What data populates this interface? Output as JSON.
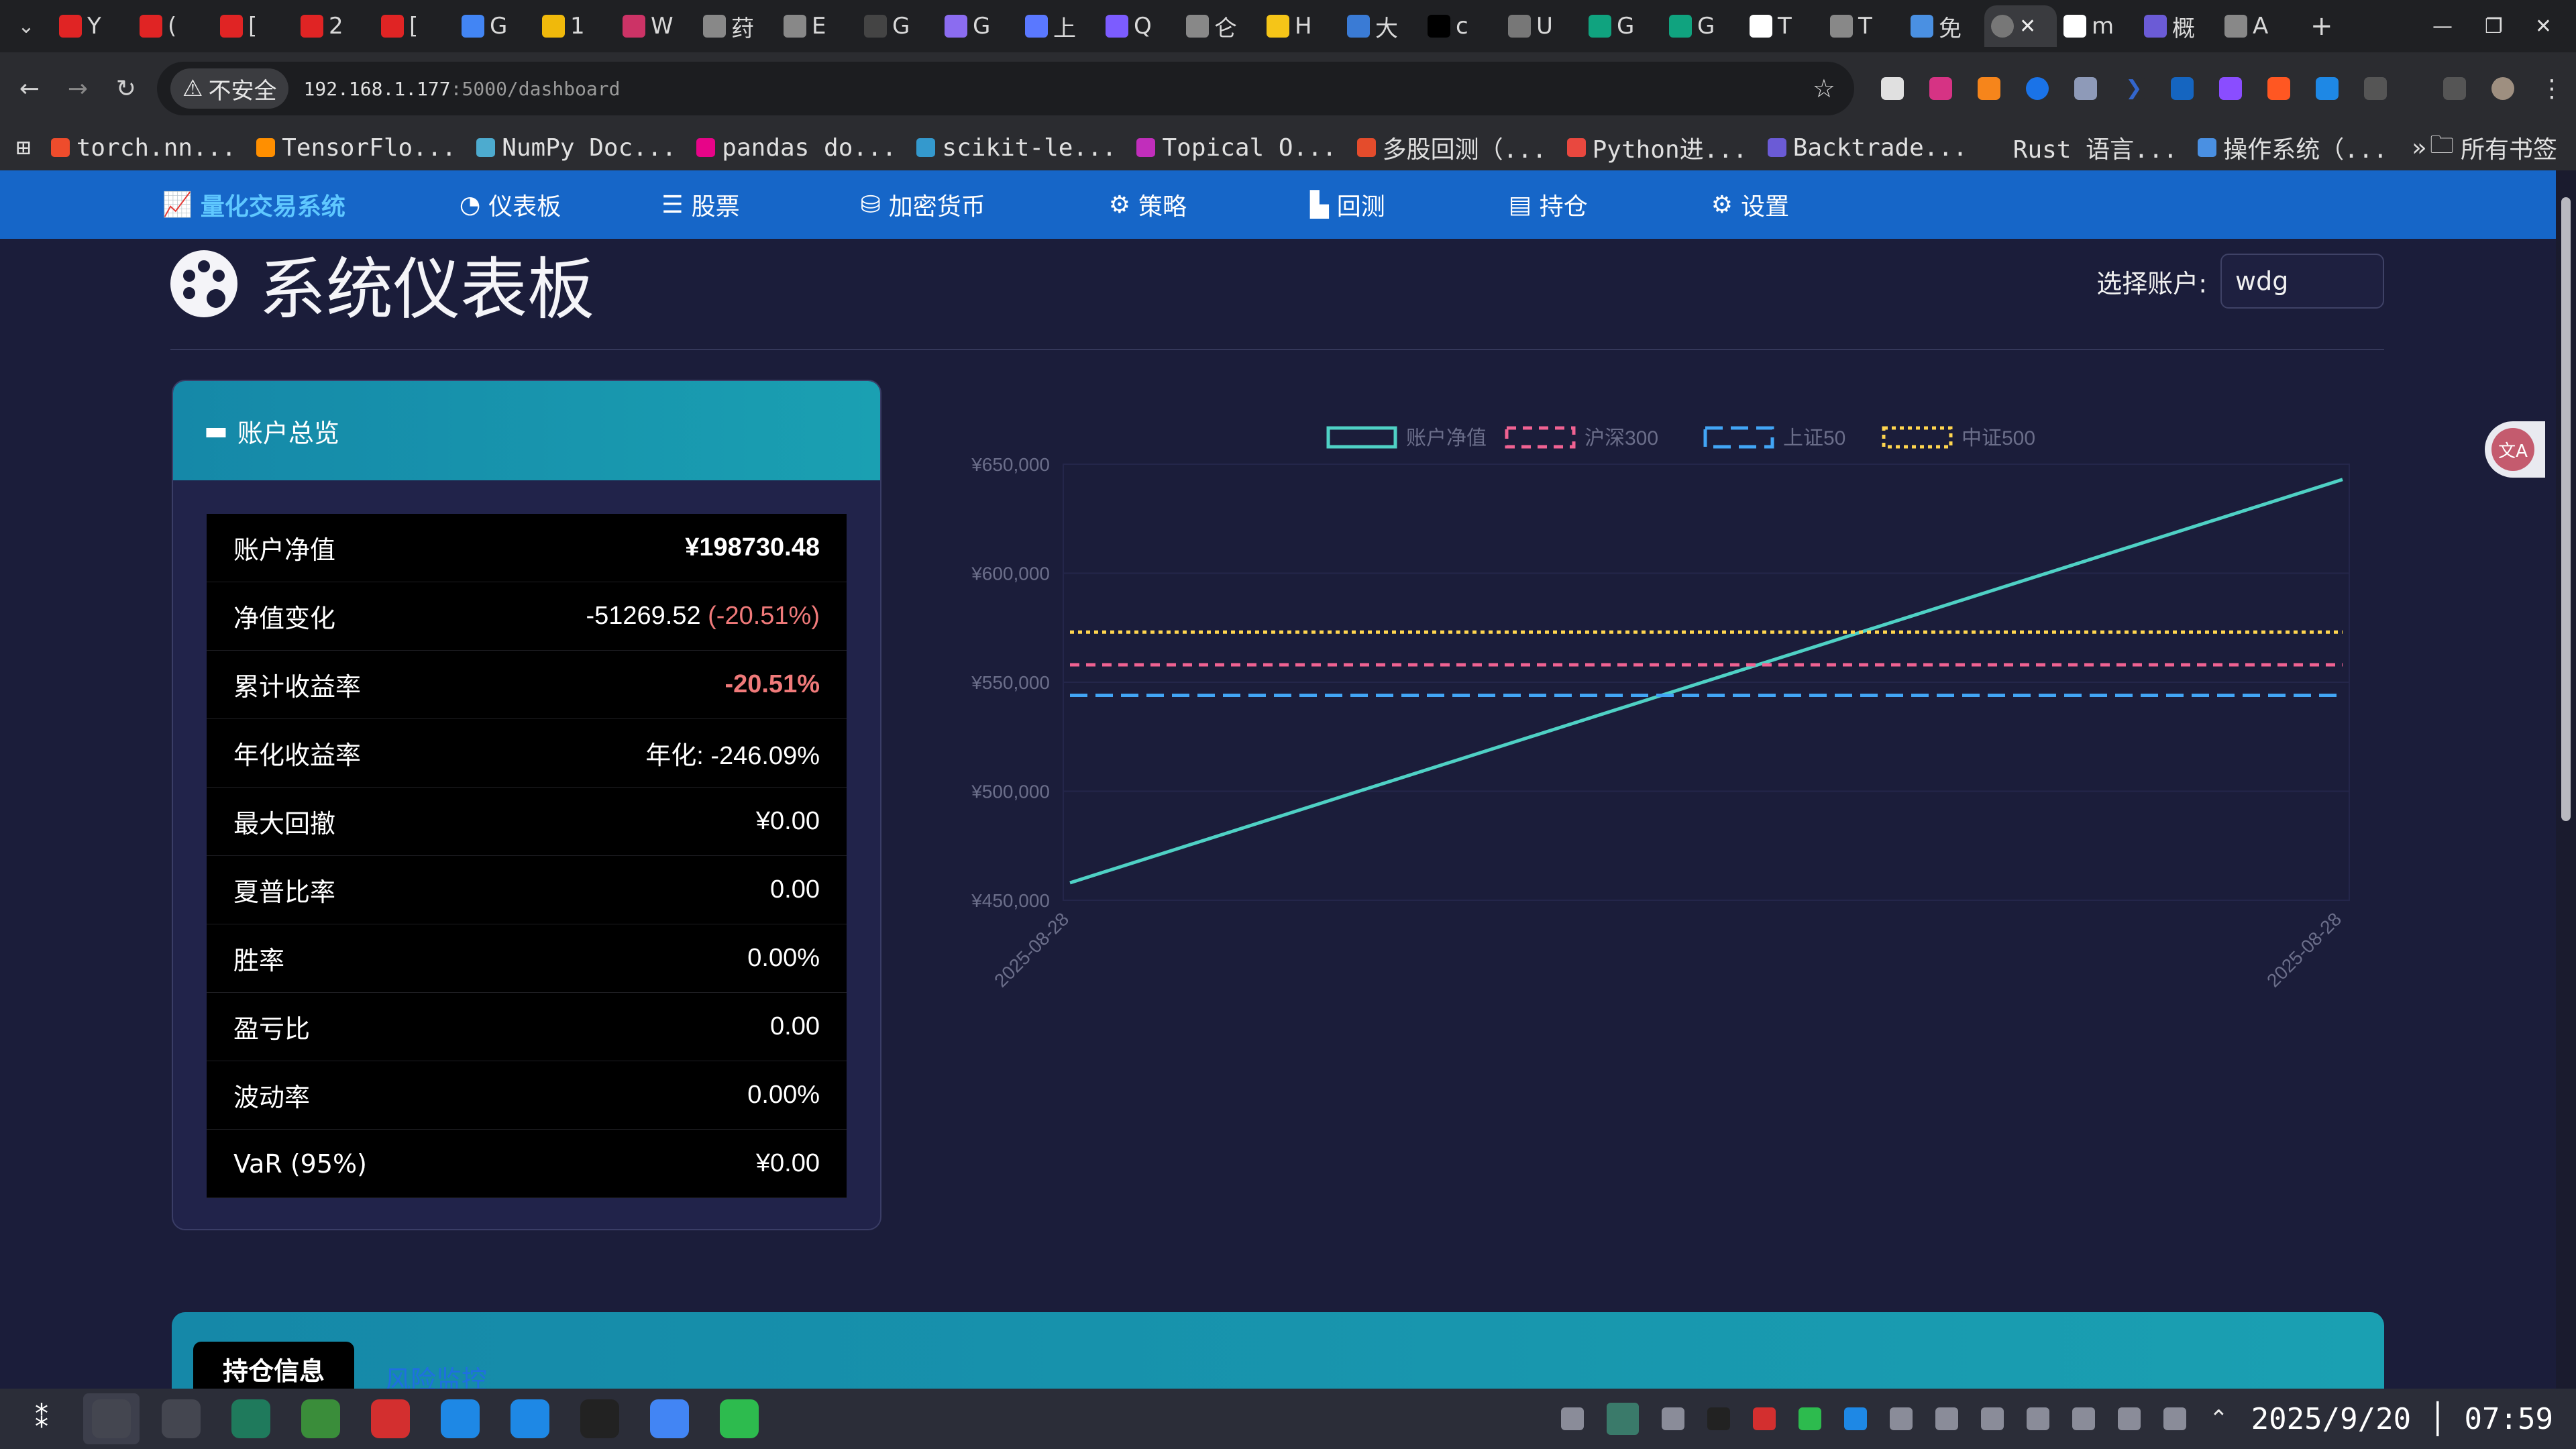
{
  "browser": {
    "tabs": [
      {
        "label": "Y",
        "color": "#e02424"
      },
      {
        "label": "(",
        "color": "#e02424"
      },
      {
        "label": "[",
        "color": "#e02424"
      },
      {
        "label": "2",
        "color": "#e02424"
      },
      {
        "label": "[",
        "color": "#e02424"
      },
      {
        "label": "G",
        "color": "#4285f4"
      },
      {
        "label": "1",
        "color": "#f0b90b"
      },
      {
        "label": "W",
        "color": "#cc3366"
      },
      {
        "label": "荮",
        "color": "#888888"
      },
      {
        "label": "E",
        "color": "#888888"
      },
      {
        "label": "G",
        "color": "#444444"
      },
      {
        "label": "G",
        "color": "#8b6cf0"
      },
      {
        "label": "上",
        "color": "#5a78ff"
      },
      {
        "label": "Q",
        "color": "#7c5cff"
      },
      {
        "label": "仑",
        "color": "#888888"
      },
      {
        "label": "H",
        "color": "#f5c518"
      },
      {
        "label": "大",
        "color": "#3a7bd5"
      },
      {
        "label": "c",
        "color": "#000000"
      },
      {
        "label": "U",
        "color": "#777777"
      },
      {
        "label": "G",
        "color": "#10a37f"
      },
      {
        "label": "G",
        "color": "#10a37f"
      },
      {
        "label": "T",
        "color": "#ffffff"
      },
      {
        "label": "T",
        "color": "#888888"
      },
      {
        "label": "免",
        "color": "#4a90e2"
      }
    ],
    "active_tab_close": "✕",
    "active_tab_icon_color": "#777777",
    "trailing_tabs": [
      {
        "label": "m",
        "color": "#ffffff"
      },
      {
        "label": "概",
        "color": "#6b5bd6"
      },
      {
        "label": "A",
        "color": "#888888"
      }
    ],
    "new_tab": "+",
    "window_controls": [
      "—",
      "❐",
      "✕"
    ],
    "insecure_label": "不安全",
    "url_host": "192.168.1.177",
    "url_rest": ":5000/dashboard",
    "bookmarks": [
      {
        "label": "torch.nn...",
        "color": "#ee4c2c"
      },
      {
        "label": "TensorFlo...",
        "color": "#ff8f00"
      },
      {
        "label": "NumPy Doc...",
        "color": "#4dabcf"
      },
      {
        "label": "pandas do...",
        "color": "#e70488"
      },
      {
        "label": "scikit-le...",
        "color": "#3499cd"
      },
      {
        "label": "Topical O...",
        "color": "#c12ebb"
      },
      {
        "label": "多股回测（...",
        "color": "#e44c2c"
      },
      {
        "label": "Python进...",
        "color": "#e9483f"
      },
      {
        "label": "Backtrade...",
        "color": "#6b5bd6"
      },
      {
        "label": "Rust 语言...",
        "color": "#2b2c30"
      },
      {
        "label": "操作系统（...",
        "color": "#4a90e2"
      }
    ],
    "bookmarks_more": "»",
    "all_bookmarks": "所有书签"
  },
  "nav": {
    "brand": "量化交易系统",
    "links": [
      "仪表板",
      "股票",
      "加密货币",
      "策略",
      "回测",
      "持仓",
      "设置"
    ]
  },
  "page": {
    "title": "系统仪表板",
    "account_label": "选择账户:",
    "account_value": "wdg"
  },
  "overview": {
    "title": "账户总览",
    "rows": [
      {
        "label": "账户净值",
        "value": "¥198730.48",
        "extra": ""
      },
      {
        "label": "净值变化",
        "value": "-51269.52",
        "extra": "(-20.51%)"
      },
      {
        "label": "累计收益率",
        "value": "",
        "extra": "-20.51%"
      },
      {
        "label": "年化收益率",
        "value": "年化: -246.09%",
        "extra": ""
      },
      {
        "label": "最大回撤",
        "value": "¥0.00",
        "extra": ""
      },
      {
        "label": "夏普比率",
        "value": "0.00",
        "extra": ""
      },
      {
        "label": "胜率",
        "value": "0.00%",
        "extra": ""
      },
      {
        "label": "盈亏比",
        "value": "0.00",
        "extra": ""
      },
      {
        "label": "波动率",
        "value": "0.00%",
        "extra": ""
      },
      {
        "label": "VaR (95%)",
        "value": "¥0.00",
        "extra": ""
      }
    ]
  },
  "chart_data": {
    "type": "line",
    "x": [
      "2025-08-28",
      "2025-08-28"
    ],
    "series": [
      {
        "name": "账户净值",
        "values": [
          458000,
          643000
        ],
        "color": "#4fd1c5",
        "dash": "solid"
      },
      {
        "name": "沪深300",
        "values": [
          558000,
          558000
        ],
        "color": "#f06292",
        "dash": "dashed"
      },
      {
        "name": "上证50",
        "values": [
          544000,
          544000
        ],
        "color": "#42a5f5",
        "dash": "long-dashed"
      },
      {
        "name": "中证500",
        "values": [
          573000,
          573000
        ],
        "color": "#ffd54f",
        "dash": "dotted"
      }
    ],
    "ylim": [
      450000,
      650000
    ],
    "yticks": [
      450000,
      500000,
      550000,
      600000,
      650000
    ],
    "ytick_labels": [
      "¥450,000",
      "¥500,000",
      "¥550,000",
      "¥600,000",
      "¥650,000"
    ],
    "legend_position": "top",
    "title": "",
    "xlabel": "",
    "ylabel": ""
  },
  "holdings": {
    "tab_active": "持仓信息",
    "tab_other": "风险监控"
  },
  "taskbar": {
    "apps": [
      "#444650",
      "#444650",
      "#1f7a5c",
      "#3a8d3a",
      "#d32f2f",
      "#1e88e5",
      "#1e88e5",
      "#222222",
      "#4285f4",
      "#2dbb4e"
    ],
    "date": "2025/9/20",
    "time": "07:59"
  }
}
